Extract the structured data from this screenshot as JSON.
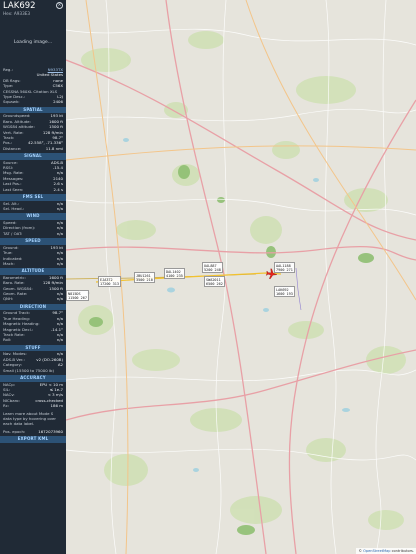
{
  "sidebar": {
    "callsign": "LAK692",
    "hex": "Hex: A933E3",
    "close_icon": "close-icon",
    "photo_text": "Loading image...",
    "info": [
      {
        "label": "Reg.:",
        "value": "N933TX",
        "link": true
      },
      {
        "label": "",
        "value": "United States"
      },
      {
        "label": "DB flags:",
        "value": "none"
      },
      {
        "label": "Type:",
        "value": "C56X"
      },
      {
        "label": "CESSNA 560XL Citation XLS",
        "value": ""
      },
      {
        "label": "Type Desc.:",
        "value": "L2J"
      },
      {
        "label": "Squawk:",
        "value": "2406"
      }
    ],
    "sections": [
      {
        "title": "SPATIAL",
        "rows": [
          {
            "label": "Groundspeed:",
            "value": "193 kt"
          },
          {
            "label": "Baro. Altitude:",
            "value": "1600 ft"
          },
          {
            "label": "WGS84 altitude:",
            "value": "1500 ft"
          },
          {
            "label": "Vert. Rate:",
            "value": "128 ft/min"
          },
          {
            "label": "Track:",
            "value": "98.7°"
          },
          {
            "label": "Pos.:",
            "value": "42.558°, -71.336°"
          },
          {
            "label": "Distance:",
            "value": "11.8 nmi"
          }
        ]
      },
      {
        "title": "SIGNAL",
        "rows": [
          {
            "label": "Source:",
            "value": "ADS-B"
          },
          {
            "label": "RSSI:",
            "value": "-15.4"
          },
          {
            "label": "Msg. Rate:",
            "value": "n/a"
          },
          {
            "label": "Messages:",
            "value": "2140"
          },
          {
            "label": "Last Pos.:",
            "value": "2.6 s"
          },
          {
            "label": "Last Seen:",
            "value": "2.4 s"
          }
        ]
      },
      {
        "title": "FMS SEL",
        "rows": [
          {
            "label": "Sel. Alt.:",
            "value": "n/a"
          },
          {
            "label": "Sel. Head.:",
            "value": "n/a"
          }
        ]
      },
      {
        "title": "WIND",
        "rows": [
          {
            "label": "Speed:",
            "value": "n/a"
          },
          {
            "label": "Direction (from):",
            "value": "n/a"
          },
          {
            "label": "TAT / OAT:",
            "value": "n/a"
          }
        ]
      },
      {
        "title": "SPEED",
        "rows": [
          {
            "label": "Ground:",
            "value": "193 kt"
          },
          {
            "label": "True:",
            "value": "n/a"
          },
          {
            "label": "Indicated:",
            "value": "n/a"
          },
          {
            "label": "Mach:",
            "value": "n/a"
          }
        ]
      },
      {
        "title": "ALTITUDE",
        "rows": [
          {
            "label": "Barometric:",
            "value": "1600 ft"
          },
          {
            "label": "Baro. Rate:",
            "value": "128 ft/min"
          },
          {
            "label": "Geom. WGS84:",
            "value": "1500 ft"
          },
          {
            "label": "Geom. Rate:",
            "value": "n/a"
          },
          {
            "label": "QNH:",
            "value": "n/a"
          }
        ]
      },
      {
        "title": "DIRECTION",
        "rows": [
          {
            "label": "Ground Track:",
            "value": "98.7°"
          },
          {
            "label": "True Heading:",
            "value": "n/a"
          },
          {
            "label": "Magnetic Heading:",
            "value": "n/a"
          },
          {
            "label": "Magnetic Decl.:",
            "value": "-14.1°"
          },
          {
            "label": "Track Rate:",
            "value": "n/a"
          },
          {
            "label": "Roll:",
            "value": "n/a"
          }
        ]
      },
      {
        "title": "STUFF",
        "rows": [
          {
            "label": "Nav. Modes:",
            "value": "n/a"
          },
          {
            "label": "ADS-B Ver.:",
            "value": "v2 (DO-260B)"
          },
          {
            "label": "Category:",
            "value": "A2"
          },
          {
            "label": "Small (15500 to 75000 lb)",
            "value": ""
          }
        ]
      },
      {
        "title": "ACCURACY",
        "rows": [
          {
            "label": "NACp:",
            "value": "EPU < 10 m"
          },
          {
            "label": "SIL:",
            "value": "≤ 1e-7"
          },
          {
            "label": "NACv:",
            "value": "< 3 m/s"
          },
          {
            "label": "NICbaro:",
            "value": "cross-checked"
          },
          {
            "label": "Rc:",
            "value": "186 m"
          }
        ]
      }
    ],
    "note": "Learn more about Mode S data type by hovering over each data label.",
    "pos_epoch_label": "Pos. epoch:",
    "pos_epoch_value": "1672073960",
    "export_label": "EXPORT KML"
  },
  "map": {
    "aircraft_labels": [
      {
        "id": "selected",
        "line1": "LAK692",
        "line2": "1600 193"
      },
      {
        "id": "a2",
        "line1": "EJA372",
        "line2": "17200 313"
      },
      {
        "id": "a3",
        "line1": "N815DS",
        "line2": "11500 267"
      },
      {
        "id": "a4",
        "line1": "JBU1261",
        "line2": "3500 210"
      },
      {
        "id": "a5",
        "line1": "DAL1402",
        "line2": "4100 235"
      },
      {
        "id": "a6",
        "line1": "UAL887",
        "line2": "5200 248"
      },
      {
        "id": "a7",
        "line1": "SWA2011",
        "line2": "6500 262"
      },
      {
        "id": "a8",
        "line1": "AAL1188",
        "line2": "7900 271"
      }
    ],
    "attribution_prefix": "© ",
    "attribution_link": "OpenStreetMap",
    "attribution_suffix": " contributors.",
    "colors": {
      "selected_aircraft": "#e8241c",
      "trail": "#f2c230",
      "trail2": "#c9a63a"
    }
  }
}
